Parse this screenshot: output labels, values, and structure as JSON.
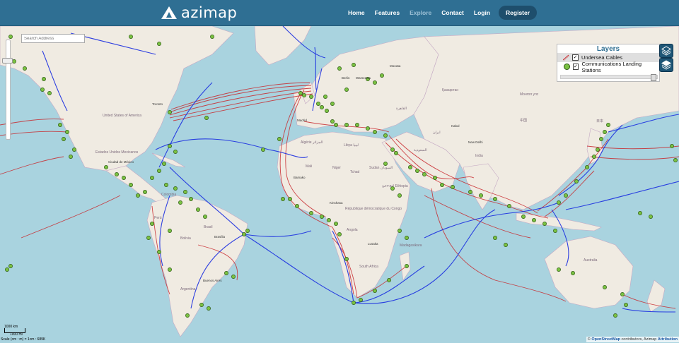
{
  "brand": {
    "name": "azimap"
  },
  "nav": {
    "items": [
      {
        "label": "Home",
        "muted": false
      },
      {
        "label": "Features",
        "muted": false
      },
      {
        "label": "Explore",
        "muted": true
      },
      {
        "label": "Contact",
        "muted": false
      },
      {
        "label": "Login",
        "muted": false
      }
    ],
    "register_label": "Register"
  },
  "search": {
    "placeholder": "Search Address"
  },
  "layers_panel": {
    "title": "Layers",
    "layers": [
      {
        "label": "Undersea Cables",
        "checked": true
      },
      {
        "label": "Communications Landing Stations",
        "checked": true
      }
    ]
  },
  "scale": {
    "km_label": "1000 km",
    "mi_label": "1000 mi",
    "ratio_text": "Scale (cm : m) = 1cm : 689K"
  },
  "attribution": {
    "prefix": "©",
    "osm": "OpenStreetMap",
    "middle": "contributors, Azimap",
    "link": "Attribution"
  },
  "map_labels": {
    "usa": "United States of America",
    "mexico": "Estados Unidos Mexicanos",
    "cdmx": "Ciudad de México",
    "colombia": "Colombia",
    "brasil": "Brasil",
    "brasilia": "Brasília",
    "bolivia": "Bolivia",
    "peru": "Perú",
    "argentina": "Argentina",
    "buenos": "Buenos Aires",
    "toronto": "Toronto",
    "madrid": "Madrid",
    "berlin": "Berlin",
    "warszawa": "Warszawa",
    "moskva": "Москва",
    "kazakh": "Қазақстан",
    "algerie": "Algérie الجزائر",
    "libya": "Libya ليبيا",
    "mali": "Mali",
    "niger": "Niger",
    "tchad": "Tchad",
    "sudan": "Sudan السودان",
    "ethiopia": "ኢትዮጵያ Ethiopia",
    "congo": "République démocratique du Congo",
    "angola": "Angola",
    "lusaka": "Lusaka",
    "south_africa": "South Africa",
    "madagascar": "Madagasikara",
    "cairo": "القاهرة",
    "saudi": "السعودية",
    "iran": "ایران",
    "kabul": "Kabul",
    "india": "India",
    "new_delhi": "New Delhi",
    "china": "中国",
    "mongolia": "Монгол улс",
    "japan": "日本",
    "australia": "Australia",
    "bamako": "Bamako",
    "kinshasa": "Kinshasa"
  },
  "colors": {
    "header": "#2f6f93",
    "ocean": "#a9d3df",
    "land": "#f0ebe2",
    "cable_red": "#c8282d",
    "cable_blue": "#1a2ee0",
    "station": "#7ac142"
  }
}
